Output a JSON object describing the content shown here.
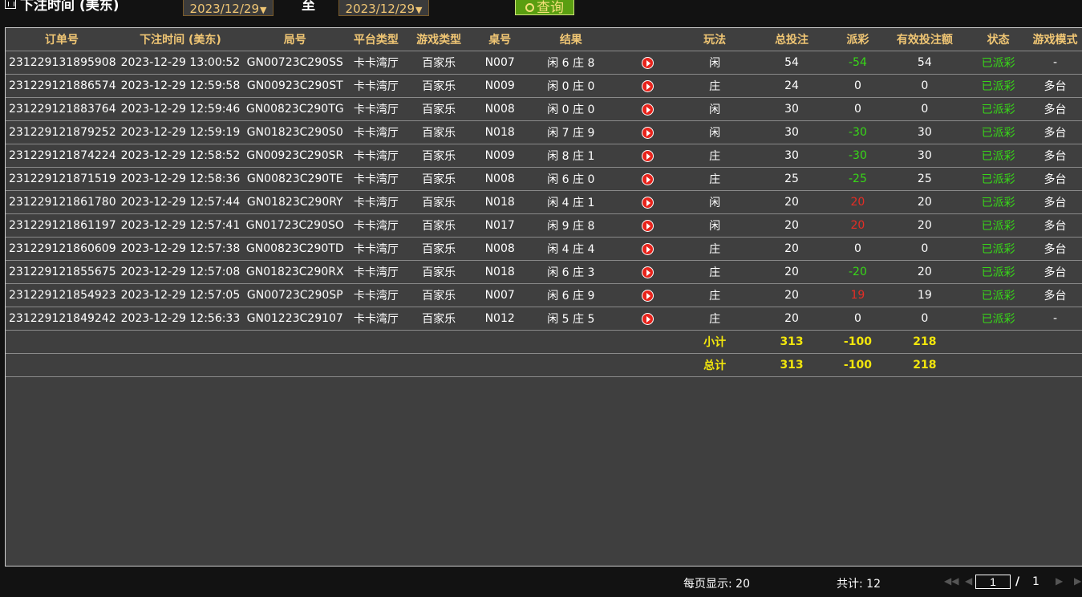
{
  "topbar": {
    "title": "下注时间 (美东)",
    "date_from": "2023/12/29",
    "separator": "至",
    "date_to": "2023/12/29",
    "query_label": "查询"
  },
  "columns": [
    "订单号",
    "下注时间 (美东)",
    "局号",
    "平台类型",
    "游戏类型",
    "桌号",
    "结果",
    "",
    "玩法",
    "总投注",
    "派彩",
    "有效投注额",
    "状态",
    "游戏模式"
  ],
  "rows": [
    {
      "order": "231229131895908",
      "time": "2023-12-29 13:00:52",
      "round": "GN00723C290SS",
      "platform": "卡卡湾厅",
      "game": "百家乐",
      "table": "N007",
      "result": "闲 6 庄 8",
      "play": "闲",
      "bet": "54",
      "payout": "-54",
      "payout_color": "green",
      "valid": "54",
      "status": "已派彩",
      "mode": "-"
    },
    {
      "order": "231229121886574",
      "time": "2023-12-29 12:59:58",
      "round": "GN00923C290ST",
      "platform": "卡卡湾厅",
      "game": "百家乐",
      "table": "N009",
      "result": "闲 0 庄 0",
      "play": "庄",
      "bet": "24",
      "payout": "0",
      "payout_color": "white",
      "valid": "0",
      "status": "已派彩",
      "mode": "多台"
    },
    {
      "order": "231229121883764",
      "time": "2023-12-29 12:59:46",
      "round": "GN00823C290TG",
      "platform": "卡卡湾厅",
      "game": "百家乐",
      "table": "N008",
      "result": "闲 0 庄 0",
      "play": "闲",
      "bet": "30",
      "payout": "0",
      "payout_color": "white",
      "valid": "0",
      "status": "已派彩",
      "mode": "多台"
    },
    {
      "order": "231229121879252",
      "time": "2023-12-29 12:59:19",
      "round": "GN01823C290S0",
      "platform": "卡卡湾厅",
      "game": "百家乐",
      "table": "N018",
      "result": "闲 7 庄 9",
      "play": "闲",
      "bet": "30",
      "payout": "-30",
      "payout_color": "green",
      "valid": "30",
      "status": "已派彩",
      "mode": "多台"
    },
    {
      "order": "231229121874224",
      "time": "2023-12-29 12:58:52",
      "round": "GN00923C290SR",
      "platform": "卡卡湾厅",
      "game": "百家乐",
      "table": "N009",
      "result": "闲 8 庄 1",
      "play": "庄",
      "bet": "30",
      "payout": "-30",
      "payout_color": "green",
      "valid": "30",
      "status": "已派彩",
      "mode": "多台"
    },
    {
      "order": "231229121871519",
      "time": "2023-12-29 12:58:36",
      "round": "GN00823C290TE",
      "platform": "卡卡湾厅",
      "game": "百家乐",
      "table": "N008",
      "result": "闲 6 庄 0",
      "play": "庄",
      "bet": "25",
      "payout": "-25",
      "payout_color": "green",
      "valid": "25",
      "status": "已派彩",
      "mode": "多台"
    },
    {
      "order": "231229121861780",
      "time": "2023-12-29 12:57:44",
      "round": "GN01823C290RY",
      "platform": "卡卡湾厅",
      "game": "百家乐",
      "table": "N018",
      "result": "闲 4 庄 1",
      "play": "闲",
      "bet": "20",
      "payout": "20",
      "payout_color": "red",
      "valid": "20",
      "status": "已派彩",
      "mode": "多台"
    },
    {
      "order": "231229121861197",
      "time": "2023-12-29 12:57:41",
      "round": "GN01723C290SO",
      "platform": "卡卡湾厅",
      "game": "百家乐",
      "table": "N017",
      "result": "闲 9 庄 8",
      "play": "闲",
      "bet": "20",
      "payout": "20",
      "payout_color": "red",
      "valid": "20",
      "status": "已派彩",
      "mode": "多台"
    },
    {
      "order": "231229121860609",
      "time": "2023-12-29 12:57:38",
      "round": "GN00823C290TD",
      "platform": "卡卡湾厅",
      "game": "百家乐",
      "table": "N008",
      "result": "闲 4 庄 4",
      "play": "庄",
      "bet": "20",
      "payout": "0",
      "payout_color": "white",
      "valid": "0",
      "status": "已派彩",
      "mode": "多台"
    },
    {
      "order": "231229121855675",
      "time": "2023-12-29 12:57:08",
      "round": "GN01823C290RX",
      "platform": "卡卡湾厅",
      "game": "百家乐",
      "table": "N018",
      "result": "闲 6 庄 3",
      "play": "庄",
      "bet": "20",
      "payout": "-20",
      "payout_color": "green",
      "valid": "20",
      "status": "已派彩",
      "mode": "多台"
    },
    {
      "order": "231229121854923",
      "time": "2023-12-29 12:57:05",
      "round": "GN00723C290SP",
      "platform": "卡卡湾厅",
      "game": "百家乐",
      "table": "N007",
      "result": "闲 6 庄 9",
      "play": "庄",
      "bet": "20",
      "payout": "19",
      "payout_color": "red",
      "valid": "19",
      "status": "已派彩",
      "mode": "多台"
    },
    {
      "order": "231229121849242",
      "time": "2023-12-29 12:56:33",
      "round": "GN01223C29107",
      "platform": "卡卡湾厅",
      "game": "百家乐",
      "table": "N012",
      "result": "闲 5 庄 5",
      "play": "庄",
      "bet": "20",
      "payout": "0",
      "payout_color": "white",
      "valid": "0",
      "status": "已派彩",
      "mode": "-"
    }
  ],
  "subtotal": {
    "label": "小计",
    "bet": "313",
    "payout": "-100",
    "valid": "218"
  },
  "total": {
    "label": "总计",
    "bet": "313",
    "payout": "-100",
    "valid": "218"
  },
  "footer": {
    "per_page": "每页显示: 20",
    "count": "共计: 12",
    "page_current": "1",
    "page_sep": "/",
    "page_total": "1"
  },
  "colors": {
    "gold": "#f0c674",
    "green": "#37d817",
    "red": "#e52d25",
    "yellow": "#f2e60c"
  },
  "icons": {
    "row_action": "play-icon",
    "topbar": "calendar-icon",
    "query": "search-icon"
  }
}
